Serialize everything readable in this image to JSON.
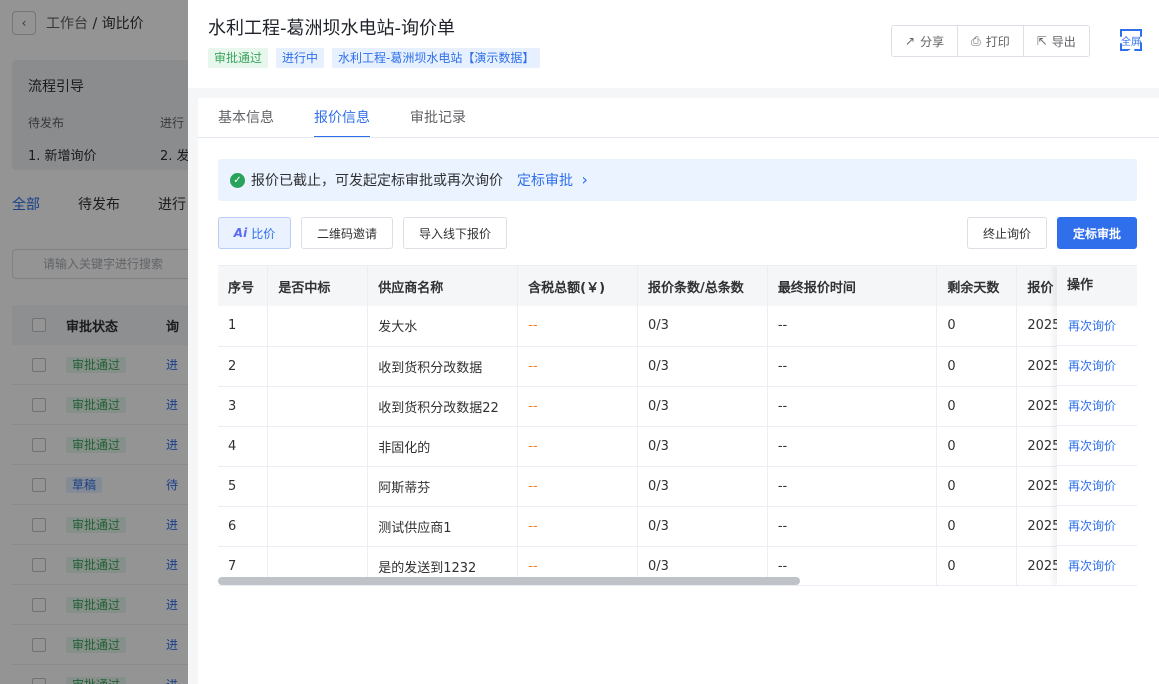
{
  "background": {
    "breadcrumb": {
      "back_icon": "chevron-left-icon",
      "root": "工作台",
      "current": "/ 询比价"
    },
    "flow": {
      "title": "流程引导",
      "steps": [
        "待发布",
        "进行"
      ],
      "numbers": [
        "1. 新增询价",
        "2. 发"
      ]
    },
    "tabs": [
      "全部",
      "待发布",
      "进行"
    ],
    "search_placeholder": "请输入关键字进行搜索",
    "table": {
      "header": [
        "审批状态",
        "询"
      ],
      "rows": [
        {
          "status": "审批通过",
          "type": "approved",
          "extra": "进"
        },
        {
          "status": "审批通过",
          "type": "approved",
          "extra": "进"
        },
        {
          "status": "审批通过",
          "type": "approved",
          "extra": "进"
        },
        {
          "status": "草稿",
          "type": "draft",
          "extra": "待"
        },
        {
          "status": "审批通过",
          "type": "approved",
          "extra": "进"
        },
        {
          "status": "审批通过",
          "type": "approved",
          "extra": "进"
        },
        {
          "status": "审批通过",
          "type": "approved",
          "extra": "进"
        },
        {
          "status": "审批通过",
          "type": "approved",
          "extra": "进"
        },
        {
          "status": "审批通过",
          "type": "approved",
          "extra": "进"
        }
      ]
    }
  },
  "drawer": {
    "title": "水利工程-葛洲坝水电站-询价单",
    "tags": [
      {
        "label": "审批通过",
        "color": "green"
      },
      {
        "label": "进行中",
        "color": "blue"
      },
      {
        "label": "水利工程-葛洲坝水电站【演示数据】",
        "color": "blue"
      }
    ],
    "actions": [
      {
        "label": "分享",
        "icon": "share-icon",
        "glyph": "↗"
      },
      {
        "label": "打印",
        "icon": "printer-icon",
        "glyph": "⎙"
      },
      {
        "label": "导出",
        "icon": "export-icon",
        "glyph": "⇱"
      }
    ],
    "fullscreen_label": "全屏",
    "tabs": [
      "基本信息",
      "报价信息",
      "审批记录"
    ],
    "active_tab": 1,
    "alert": {
      "text": "报价已截止，可发起定标审批或再次询价",
      "link": "定标审批",
      "link_arrow": "›"
    },
    "toolbar": {
      "ai_mark": "Ai",
      "compare": "比价",
      "qrcode": "二维码邀请",
      "import": "导入线下报价",
      "terminate": "终止询价",
      "award": "定标审批"
    },
    "table": {
      "columns": [
        "序号",
        "是否中标",
        "供应商名称",
        "含税总额(￥)",
        "报价条数/总条数",
        "最终报价时间",
        "剩余天数",
        "报价"
      ],
      "operation_header": "操作",
      "operation_label": "再次询价",
      "rows": [
        {
          "no": "1",
          "won": "",
          "supplier": "发大水",
          "amount": "--",
          "count": "0/3",
          "time": "--",
          "days": "0",
          "quote": "2025"
        },
        {
          "no": "2",
          "won": "",
          "supplier": "收到货积分改数据",
          "amount": "--",
          "count": "0/3",
          "time": "--",
          "days": "0",
          "quote": "2025"
        },
        {
          "no": "3",
          "won": "",
          "supplier": "收到货积分改数据22",
          "amount": "--",
          "count": "0/3",
          "time": "--",
          "days": "0",
          "quote": "2025"
        },
        {
          "no": "4",
          "won": "",
          "supplier": "非固化的",
          "amount": "--",
          "count": "0/3",
          "time": "--",
          "days": "0",
          "quote": "2025"
        },
        {
          "no": "5",
          "won": "",
          "supplier": "阿斯蒂芬",
          "amount": "--",
          "count": "0/3",
          "time": "--",
          "days": "0",
          "quote": "2025"
        },
        {
          "no": "6",
          "won": "",
          "supplier": "测试供应商1",
          "amount": "--",
          "count": "0/3",
          "time": "--",
          "days": "0",
          "quote": "2025"
        },
        {
          "no": "7",
          "won": "",
          "supplier": "是的发送到1232",
          "amount": "--",
          "count": "0/3",
          "time": "--",
          "days": "0",
          "quote": "2025"
        }
      ]
    }
  }
}
